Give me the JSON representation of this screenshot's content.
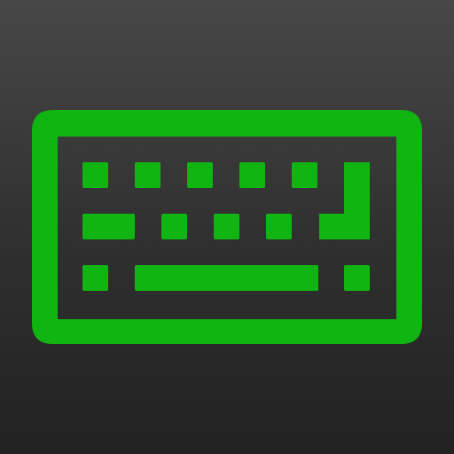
{
  "icon": {
    "name": "keyboard-icon",
    "accent_color": "#10b512",
    "background_top": "#474747",
    "background_bottom": "#222222"
  }
}
